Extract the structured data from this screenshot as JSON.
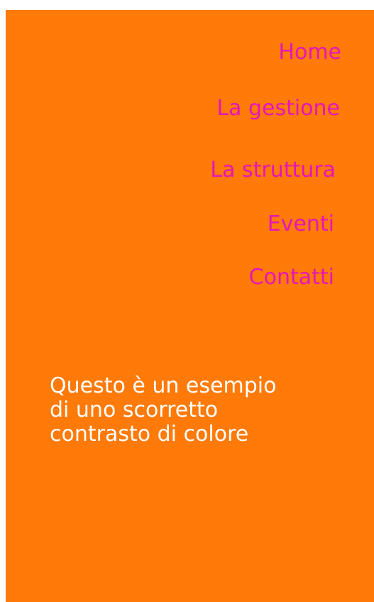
{
  "colors": {
    "background": "#ff7a08",
    "link": "#e616b7",
    "text": "#ffffff"
  },
  "nav": {
    "items": [
      {
        "label": "Home"
      },
      {
        "label": "La gestione"
      },
      {
        "label": "La struttura"
      },
      {
        "label": "Eventi"
      },
      {
        "label": "Contatti"
      }
    ]
  },
  "content": {
    "lines": [
      "Questo è un esempio",
      "di uno scorretto",
      "contrasto di colore"
    ]
  }
}
